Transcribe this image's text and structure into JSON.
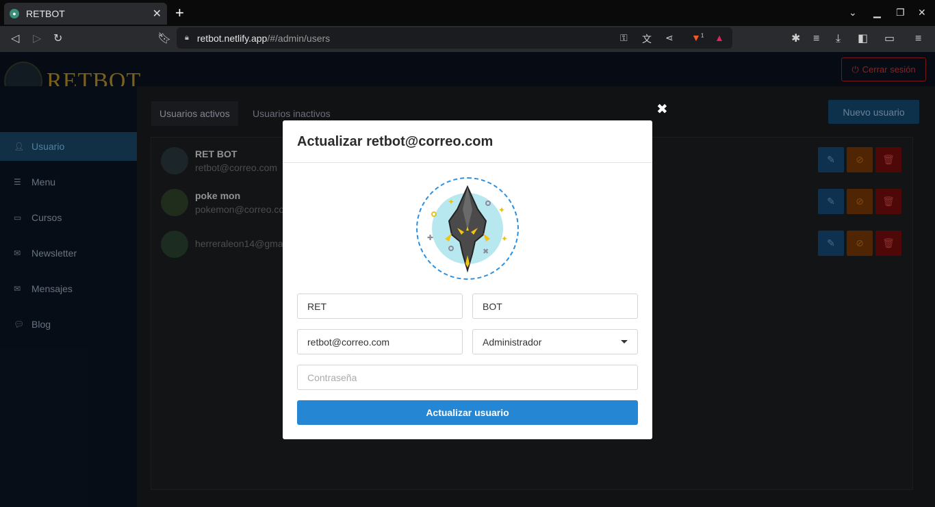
{
  "browser": {
    "tab_title": "RETBOT",
    "url_host": "retbot.netlify.app",
    "url_path": "/#/admin/users",
    "shields_badge": "1"
  },
  "app": {
    "logo_text": "RETBOT",
    "logout_label": "Cerrar sesión",
    "sidebar": {
      "items": [
        {
          "label": "Usuario",
          "icon": "user-icon"
        },
        {
          "label": "Menu",
          "icon": "menu-icon"
        },
        {
          "label": "Cursos",
          "icon": "monitor-icon"
        },
        {
          "label": "Newsletter",
          "icon": "mail-icon"
        },
        {
          "label": "Mensajes",
          "icon": "mail-icon"
        },
        {
          "label": "Blog",
          "icon": "comment-icon"
        }
      ]
    },
    "tabs": [
      {
        "label": "Usuarios activos"
      },
      {
        "label": "Usuarios inactivos"
      }
    ],
    "new_user_label": "Nuevo usuario",
    "users": [
      {
        "name": "RET BOT",
        "email": "retbot@correo.com"
      },
      {
        "name": "poke mon",
        "email": "pokemon@correo.co"
      },
      {
        "name": "",
        "email": "herreraleon14@gma"
      }
    ]
  },
  "modal": {
    "title": "Actualizar retbot@correo.com",
    "first_name": "RET",
    "last_name": "BOT",
    "email": "retbot@correo.com",
    "role": "Administrador",
    "password_placeholder": "Contraseña",
    "submit_label": "Actualizar usuario",
    "close_icon": "close-icon",
    "accent_color": "#2586d4"
  }
}
